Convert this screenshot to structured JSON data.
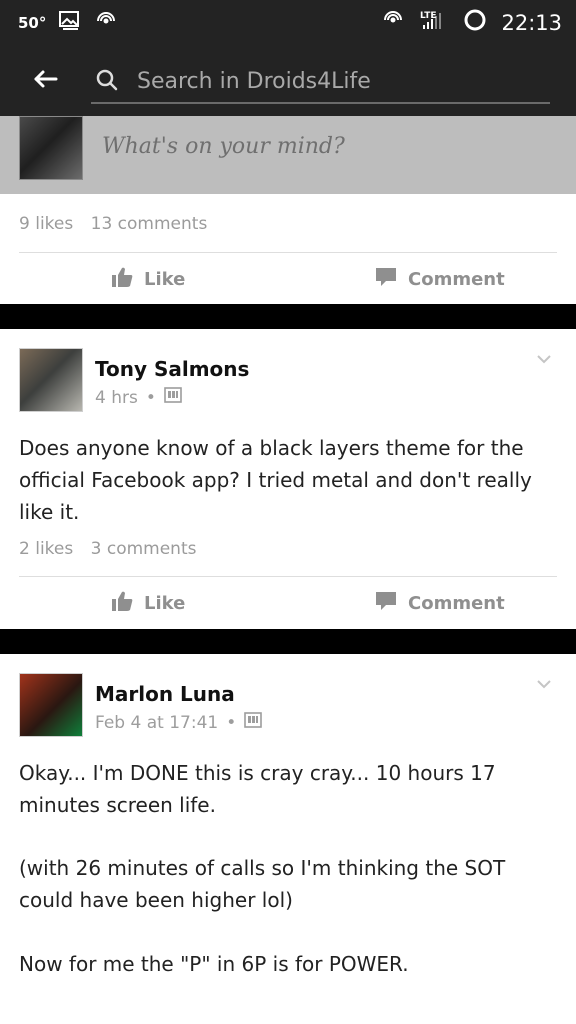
{
  "status_bar": {
    "left_temp": "50°",
    "time": "22:13",
    "left_icons": [
      "gallery-icon",
      "hotspot-icon"
    ],
    "right_icons": [
      "hotspot-icon",
      "lte-signal-icon",
      "battery-ring-icon"
    ]
  },
  "search": {
    "placeholder": "Search in Droids4Life"
  },
  "composer": {
    "prompt": "What's on your mind?"
  },
  "posts": [
    {
      "likes": "9 likes",
      "comments": "13 comments",
      "like_label": "Like",
      "comment_label": "Comment"
    },
    {
      "author": "Tony Salmons",
      "time": "4 hrs",
      "text": "Does anyone know of a black layers theme for the official Facebook app? I tried metal and don't really like it.",
      "likes": "2 likes",
      "comments": "3 comments",
      "like_label": "Like",
      "comment_label": "Comment"
    },
    {
      "author": "Marlon Luna",
      "time": "Feb 4 at 17:41",
      "text_lines": [
        "Okay... I'm DONE this is cray cray... 10 hours 17 minutes screen life.",
        "(with 26 minutes of calls so I'm thinking the SOT could have been higher lol)",
        "Now for me the \"P\" in 6P is for POWER."
      ]
    }
  ],
  "colors": {
    "status_bg": "#232323",
    "composer_bg": "#bdbdbd",
    "divider": "#dedede",
    "text": "#222222",
    "meta": "#9b9b9b"
  }
}
